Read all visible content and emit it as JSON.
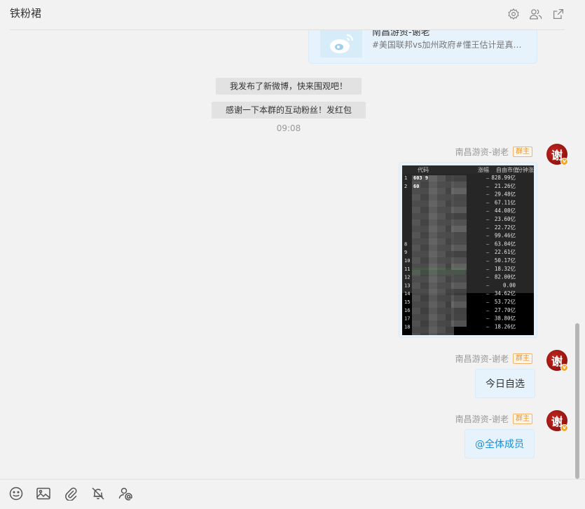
{
  "header": {
    "title": "铁粉裙",
    "icons": [
      "settings-icon",
      "group-members-icon",
      "open-external-icon"
    ]
  },
  "share_card": {
    "title": "南昌游资-谢老",
    "desc": "#美国联邦vs加州政府#懂王估计是真的…"
  },
  "system_messages": [
    "我发布了新微博，快来围观吧！",
    "感谢一下本群的互动粉丝！发红包"
  ],
  "timestamp": "09:08",
  "messages": [
    {
      "sender": "南昌游资-谢老",
      "badge": "群主",
      "type": "image",
      "table": {
        "headers": [
          "代码",
          "涨幅",
          "自由市值",
          "分钟涨"
        ],
        "rows": [
          {
            "idx": "1",
            "code": "603 9",
            "value": "828.99亿"
          },
          {
            "idx": "2",
            "code": "60",
            "value": "21.26亿"
          },
          {
            "idx": "",
            "code": "",
            "value": "29.48亿"
          },
          {
            "idx": "",
            "code": "",
            "value": "67.11亿"
          },
          {
            "idx": "",
            "code": "",
            "value": "44.08亿"
          },
          {
            "idx": "",
            "code": "",
            "value": "23.60亿"
          },
          {
            "idx": "",
            "code": "",
            "value": "22.72亿"
          },
          {
            "idx": "",
            "code": "",
            "value": "99.46亿"
          },
          {
            "idx": "8",
            "code": "",
            "value": "63.04亿"
          },
          {
            "idx": "9",
            "code": "",
            "value": "22.61亿"
          },
          {
            "idx": "10",
            "code": "",
            "value": "50.17亿"
          },
          {
            "idx": "11",
            "code": "",
            "value": "18.32亿"
          },
          {
            "idx": "12",
            "code": "",
            "value": "82.00亿"
          },
          {
            "idx": "13",
            "code": "",
            "value": "0.00"
          },
          {
            "idx": "14",
            "code": "",
            "value": "34.62亿"
          },
          {
            "idx": "15",
            "code": "",
            "value": "53.72亿"
          },
          {
            "idx": "16",
            "code": "",
            "value": "27.70亿"
          },
          {
            "idx": "17",
            "code": "",
            "value": "38.80亿"
          },
          {
            "idx": "18",
            "code": "",
            "value": "18.26亿"
          }
        ]
      }
    },
    {
      "sender": "南昌游资-谢老",
      "badge": "群主",
      "type": "text",
      "text": "今日自选"
    },
    {
      "sender": "南昌游资-谢老",
      "badge": "群主",
      "type": "text",
      "text": "@全体成员"
    }
  ],
  "avatar_char": "谢",
  "avatar_mark": "v",
  "toolbar": {
    "tools": [
      "emoji-icon",
      "image-icon",
      "attachment-icon",
      "mute-notification-icon",
      "mention-icon"
    ]
  },
  "colors": {
    "accent": "#1a8fd6",
    "bubble_bg": "#e7f3fc",
    "badge": "#f0932b",
    "background": "#f2f2f2"
  }
}
